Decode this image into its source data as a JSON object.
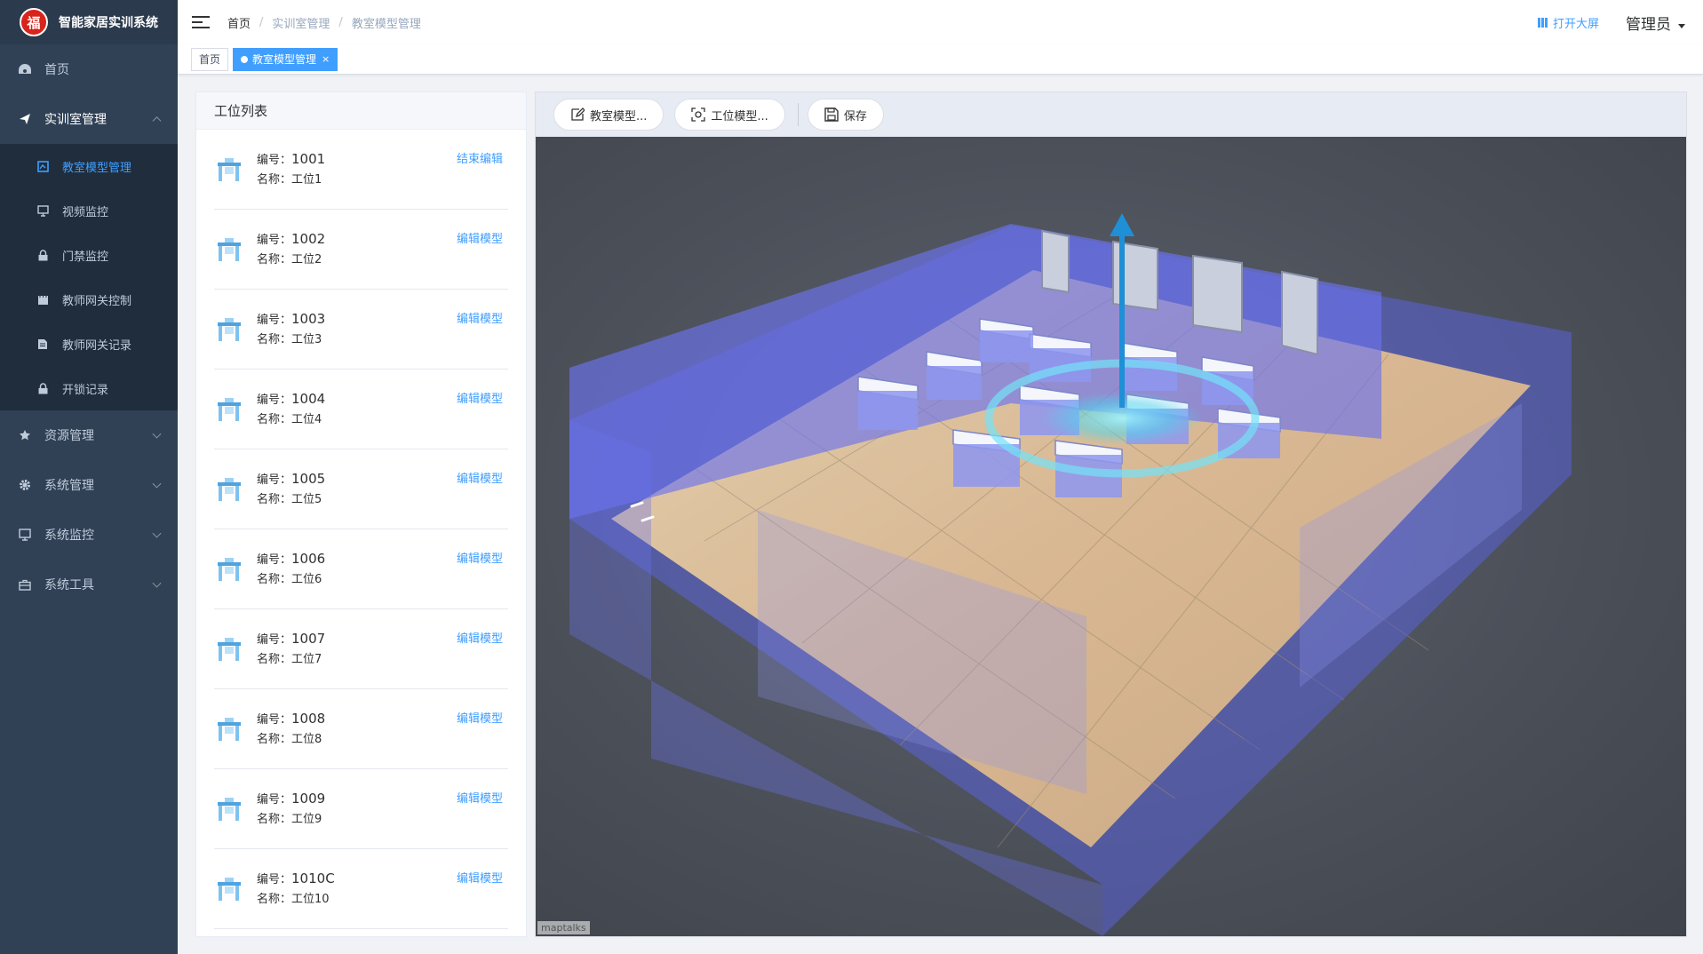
{
  "app": {
    "title": "智能家居实训系统",
    "logo_char": "福"
  },
  "sidebar": {
    "items": [
      {
        "label": "首页",
        "icon": "dashboard-icon"
      },
      {
        "label": "实训室管理",
        "icon": "send-icon",
        "open": true,
        "children": [
          {
            "label": "教室模型管理",
            "icon": "model-icon",
            "active": true
          },
          {
            "label": "视频监控",
            "icon": "monitor-icon"
          },
          {
            "label": "门禁监控",
            "icon": "lock-icon"
          },
          {
            "label": "教师网关控制",
            "icon": "gateway-icon"
          },
          {
            "label": "教师网关记录",
            "icon": "document-icon"
          },
          {
            "label": "开锁记录",
            "icon": "lock-icon"
          }
        ]
      },
      {
        "label": "资源管理",
        "icon": "star-icon"
      },
      {
        "label": "系统管理",
        "icon": "gear-icon"
      },
      {
        "label": "系统监控",
        "icon": "monitor-icon"
      },
      {
        "label": "系统工具",
        "icon": "toolbox-icon"
      }
    ]
  },
  "header": {
    "breadcrumb": [
      "首页",
      "实训室管理",
      "教室模型管理"
    ],
    "bigscreen_label": "打开大屏",
    "user": "管理员"
  },
  "tags": {
    "home": "首页",
    "current": "教室模型管理",
    "close": "×"
  },
  "list": {
    "title": "工位列表",
    "num_prefix": "编号：",
    "name_prefix": "名称：",
    "items": [
      {
        "num": "1001",
        "name": "工位1",
        "action": "结束编辑"
      },
      {
        "num": "1002",
        "name": "工位2",
        "action": "编辑模型"
      },
      {
        "num": "1003",
        "name": "工位3",
        "action": "编辑模型"
      },
      {
        "num": "1004",
        "name": "工位4",
        "action": "编辑模型"
      },
      {
        "num": "1005",
        "name": "工位5",
        "action": "编辑模型"
      },
      {
        "num": "1006",
        "name": "工位6",
        "action": "编辑模型"
      },
      {
        "num": "1007",
        "name": "工位7",
        "action": "编辑模型"
      },
      {
        "num": "1008",
        "name": "工位8",
        "action": "编辑模型"
      },
      {
        "num": "1009",
        "name": "工位9",
        "action": "编辑模型"
      },
      {
        "num": "1010C",
        "name": "工位10",
        "action": "编辑模型"
      }
    ]
  },
  "toolbar": {
    "classroom_model": "教室模型...",
    "workstation_model": "工位模型...",
    "save": "保存"
  },
  "canvas": {
    "attribution": "maptalks"
  },
  "colors": {
    "accent": "#409eff",
    "sidebar_bg": "#304156",
    "submenu_bg": "#1f2d3d"
  }
}
